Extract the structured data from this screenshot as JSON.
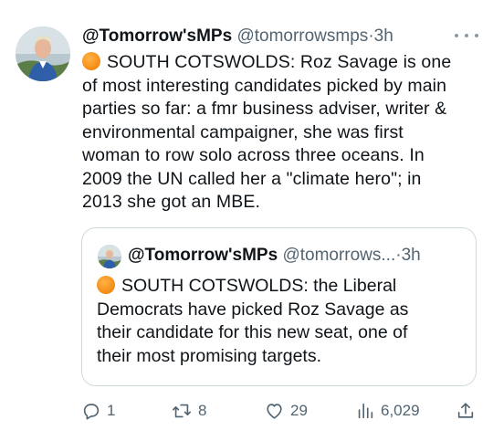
{
  "tweet": {
    "display_name": "@Tomorrow'sMPs",
    "handle": "@tomorrowsmps",
    "separator": "·",
    "time": "3h",
    "emoji_icon": "orange-circle-icon",
    "lines": [
      "SOUTH COTSWOLDS: Roz Savage is one",
      "of most interesting candidates picked by main",
      "parties so far: a fmr business adviser, writer &",
      "environmental campaigner, she was first",
      "woman to row solo across three oceans.  In",
      "2009 the UN called her a \"climate hero\"; in",
      "2013 she got an MBE."
    ]
  },
  "quoted": {
    "display_name": "@Tomorrow'sMPs",
    "handle": "@tomorrows...",
    "separator": "·",
    "time": "3h",
    "lines": [
      "SOUTH COTSWOLDS: the Liberal",
      "Democrats have picked Roz Savage as",
      "their candidate for this new seat, one of",
      "their most promising targets."
    ]
  },
  "actions": {
    "replies": "1",
    "reposts": "8",
    "likes": "29",
    "views": "6,029"
  },
  "colors": {
    "text": "#0f1419",
    "secondary": "#536471",
    "border": "#cfd9de",
    "orange": "#f7931e"
  }
}
